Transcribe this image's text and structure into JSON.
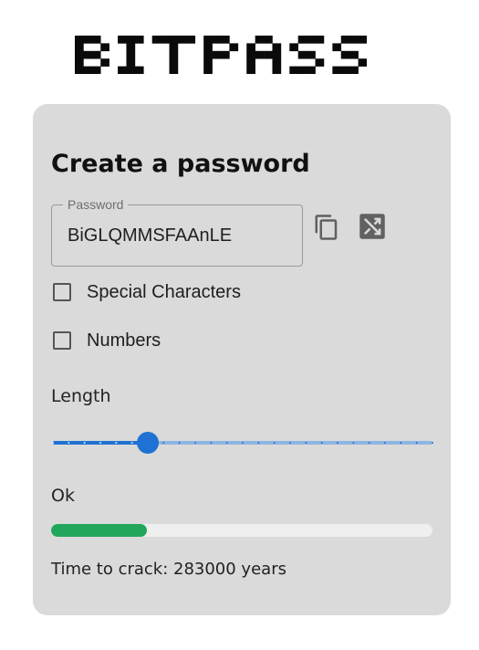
{
  "app": {
    "logo_text": "BITPASS"
  },
  "form": {
    "title": "Create a password",
    "password": {
      "label": "Password",
      "value": "BiGLQMMSFAAnLE"
    },
    "actions": [
      {
        "icon": "copy-icon"
      },
      {
        "icon": "shuffle-icon"
      }
    ],
    "options": [
      {
        "label": "Special Characters",
        "checked": false
      },
      {
        "label": "Numbers",
        "checked": false
      }
    ],
    "length": {
      "label": "Length",
      "value": 14,
      "min": 8,
      "max": 32,
      "step": 1
    },
    "strength": {
      "label": "Ok",
      "fraction": 0.25,
      "color": "#22a65b"
    },
    "time_to_crack": "Time to crack: 283000 years"
  },
  "colors": {
    "card": "#dadada",
    "accent": "#1f72d3",
    "track_light": "#8fb6e3"
  }
}
